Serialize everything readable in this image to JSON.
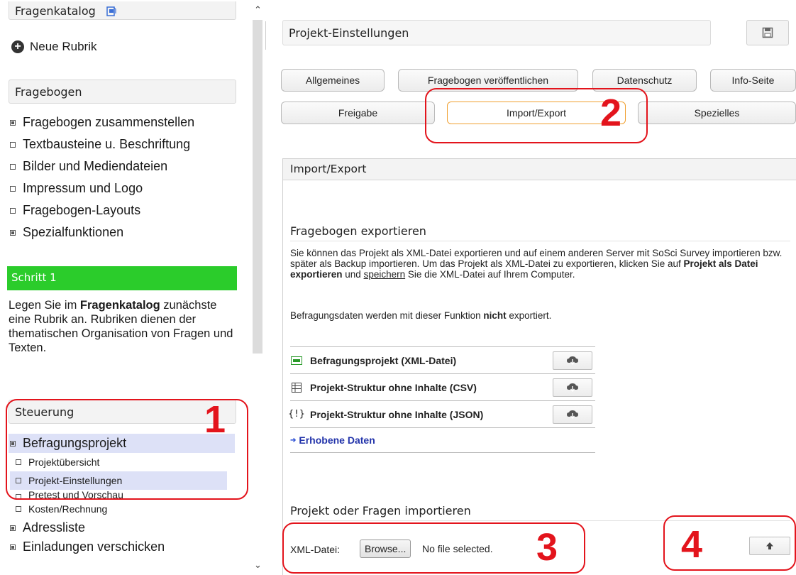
{
  "sidebar": {
    "catalog_header": "Fragenkatalog",
    "new_rubric": "Neue Rubrik",
    "questionnaire_header": "Fragebogen",
    "questionnaire_items": [
      {
        "label": "Fragebogen zusammenstellen"
      },
      {
        "label": "Textbausteine u. Beschriftung"
      },
      {
        "label": "Bilder und Mediendateien"
      },
      {
        "label": "Impressum und Logo"
      },
      {
        "label": "Fragebogen-Layouts"
      },
      {
        "label": "Spezialfunktionen"
      }
    ],
    "step": {
      "title": "Schritt 1",
      "text_before": "Legen Sie im ",
      "text_bold": "Fragenkatalog",
      "text_after": " zunächste eine Rubrik an. Rubriken dienen der thematischen Organisation von Fragen und Texten."
    },
    "control_header": "Steuerung",
    "nav": {
      "project": "Befragungsprojekt",
      "sub_items": [
        {
          "label": "Projektübersicht"
        },
        {
          "label": "Projekt-Einstellungen"
        },
        {
          "label": "Pretest und Vorschau"
        },
        {
          "label": "Kosten/Rechnung"
        }
      ],
      "address_list": "Adressliste",
      "send_invitations": "Einladungen verschicken"
    }
  },
  "main": {
    "title": "Projekt-Einstellungen",
    "tabs_row1": [
      {
        "label": "Allgemeines"
      },
      {
        "label": "Fragebogen veröffentlichen"
      },
      {
        "label": "Datenschutz"
      },
      {
        "label": "Info-Seite"
      }
    ],
    "tabs_row2": [
      {
        "label": "Freigabe"
      },
      {
        "label": "Import/Export"
      },
      {
        "label": "Spezielles"
      }
    ],
    "panel": {
      "header": "Import/Export",
      "export_title": "Fragebogen exportieren",
      "export_para": {
        "p1": "Sie können das Projekt als XML-Datei exportieren und auf einem anderen Server mit SoSci Survey importieren bzw. später als Backup importieren. Um das Projekt als XML-Datei zu exportieren, klicken Sie auf ",
        "p1_bold": "Projekt als Datei exportieren",
        "p1_mid": " und ",
        "p1_under": "speichern",
        "p1_end": " Sie die XML-Datei auf Ihrem Computer.",
        "p2": "Befragungsdaten werden mit dieser Funktion ",
        "p2_bold": "nicht",
        "p2_end": " exportiert."
      },
      "export_rows": [
        {
          "label": "Befragungsprojekt (XML-Datei)"
        },
        {
          "label": "Projekt-Struktur ohne Inhalte (CSV)"
        },
        {
          "label": "Projekt-Struktur ohne Inhalte (JSON)"
        }
      ],
      "collected_data_link": "Erhobene Daten",
      "import_title": "Projekt oder Fragen importieren",
      "import_label": "XML-Datei:",
      "browse_label": "Browse...",
      "no_file": "No file selected."
    }
  },
  "annotations": [
    "1",
    "2",
    "3",
    "4"
  ],
  "colors": {
    "step_green": "#2bcc2b",
    "annotation_red": "#e3141c",
    "active_nav": "#dde1f7",
    "active_tab_border": "#f0a030",
    "link_blue": "#2233aa"
  }
}
